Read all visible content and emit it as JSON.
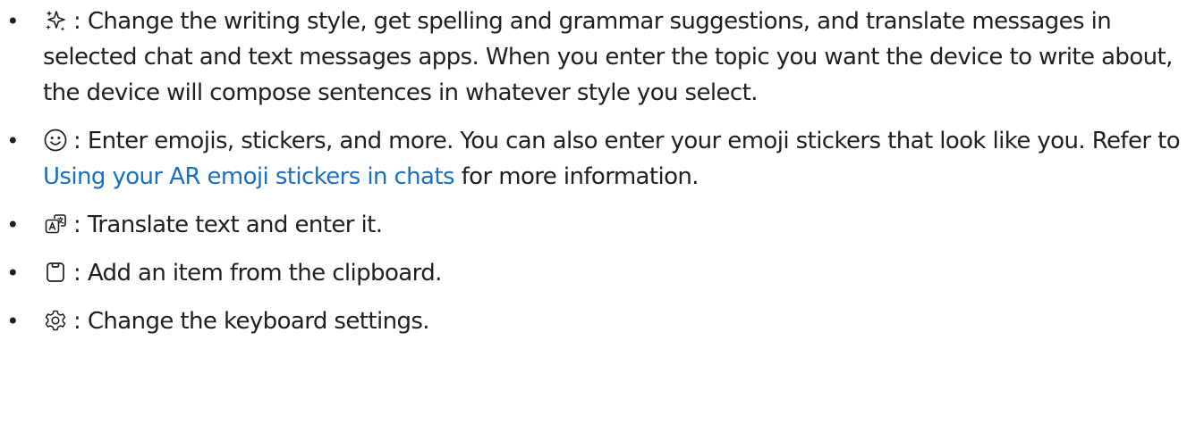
{
  "items": [
    {
      "icon": "sparkle-ai-icon",
      "text": ": Change the writing style, get spelling and grammar suggestions, and translate messages in selected chat and text messages apps. When you enter the topic you want the device to write about, the device will compose sentences in whatever style you select."
    },
    {
      "icon": "smiley-face-icon",
      "text_before": ": Enter emojis, stickers, and more. You can also enter your emoji stickers that look like you. Refer to ",
      "link": "Using your AR emoji stickers in chats",
      "text_after": " for more information."
    },
    {
      "icon": "translate-icon",
      "text": ": Translate text and enter it."
    },
    {
      "icon": "clipboard-icon",
      "text": ": Add an item from the clipboard."
    },
    {
      "icon": "gear-icon",
      "text": ": Change the keyboard settings."
    }
  ],
  "bullet_char": "•",
  "colors": {
    "text": "#1f1f1f",
    "link": "#1a6fbf"
  }
}
